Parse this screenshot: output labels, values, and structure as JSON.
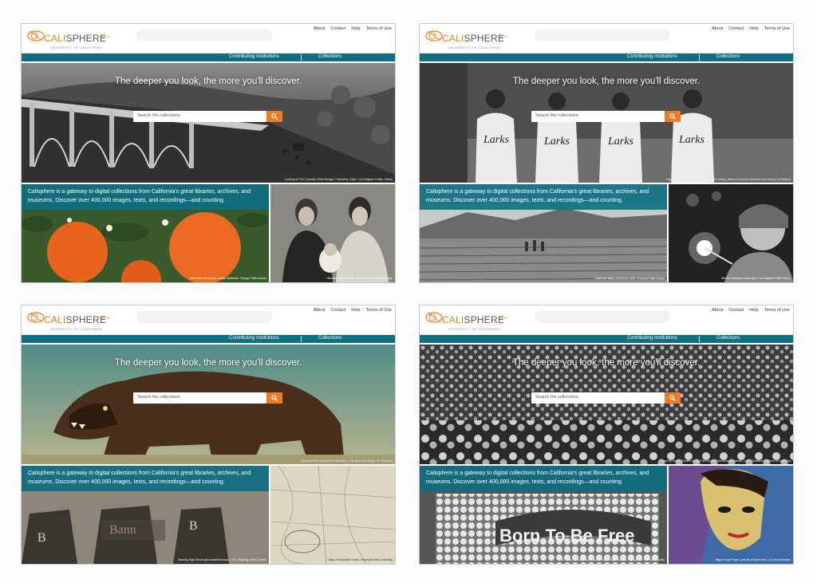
{
  "screens": [
    {
      "logo": {
        "cali": "CALI",
        "sphere": "SPHERE",
        "beta": "BETA",
        "university": "UNIVERSITY OF CALIFORNIA"
      },
      "top_links": [
        "About",
        "Contact",
        "Help",
        "Terms of Use"
      ],
      "nav": {
        "contributing": "Contributing Institutions",
        "collections": "Collections"
      },
      "hero": {
        "tagline": "The deeper you look, the more you'll discover.",
        "search_placeholder": "Search the collections",
        "credit": "Looking at The Colorado Street Bridge, Pasadena, Calif. / Los Angeles Public Library"
      },
      "gateway": "Calisphere is a gateway to digital collections from California's great libraries, archives, and museums. Discover over 400,000 images, texts, and recordings—and counting.",
      "left_caption": "Crate label for Orange County Valencias / Orange Public Library",
      "right_caption": "Hirohata family portrait, 1920s / Anaheim Public Library"
    },
    {
      "logo": {
        "cali": "CALI",
        "sphere": "SPHERE",
        "beta": "BETA",
        "university": "UNIVERSITY OF CALIFORNIA"
      },
      "top_links": [
        "About",
        "Contact",
        "Help",
        "Terms of Use"
      ],
      "nav": {
        "contributing": "Contributing Institutions",
        "collections": "Collections"
      },
      "hero": {
        "tagline": "The deeper you look, the more you'll discover.",
        "search_placeholder": "Search the collections",
        "credit": "Oakland Larks Players / Oakland Public Library, African American Museum and Library at Oakland"
      },
      "gateway": "Calisphere is a gateway to digital collections from California's great libraries, archives, and museums. Discover over 400,000 images, texts, and recordings—and counting.",
      "left_caption": "Coachella Valley onion field, 1920 / Pomona Public Library",
      "right_caption": "Woman holding a metal torch / Los Angeles Public Library"
    },
    {
      "logo": {
        "cali": "CALI",
        "sphere": "SPHERE",
        "beta": "BETA",
        "university": "UNIVERSITY OF CALIFORNIA"
      },
      "top_links": [
        "About",
        "Contact",
        "Help",
        "Terms of Use"
      ],
      "nav": {
        "contributing": "Contributing Institutions",
        "collections": "Collections"
      },
      "hero": {
        "tagline": "The deeper you look, the more you'll discover.",
        "search_placeholder": "Search the collections",
        "credit": "Nucleus Bear Brand fruit crate label / The Bancroft Library, UC Berkeley"
      },
      "gateway": "Calisphere is a gateway to digital collections from California's great libraries, archives, and museums. Discover over 400,000 images, texts, and recordings—and counting.",
      "left_caption": "Banning High School girls basketball team, 1911 / Banning Library District",
      "right_caption": "Atlas of Humboldt County / Humboldt State University"
    },
    {
      "logo": {
        "cali": "CALI",
        "sphere": "SPHERE",
        "beta": "BETA",
        "university": "UNIVERSITY OF CALIFORNIA"
      },
      "top_links": [
        "About",
        "Contact",
        "Help",
        "Terms of Use"
      ],
      "nav": {
        "contributing": "Contributing Institutions",
        "collections": "Collections"
      },
      "hero": {
        "tagline": "The deeper you look, the more you'll discover.",
        "search_placeholder": "Search the collections",
        "credit": "Crowd at Greek Theater during Free Speech Movement protests, 1964 / Oakland Museum of California"
      },
      "gateway": "Calisphere is a gateway to digital collections from California's great libraries, archives, and museums. Discover over 400,000 images, texts, and recordings—and counting.",
      "left_caption": "1977 Gay Freedom Day Parade / Gay Lesbian Bisexual Transgender Historical Society",
      "right_caption": "Miguel Angel Reyes, portrait of Maria Felix / UC Santa Barbara"
    }
  ],
  "theme": {
    "teal": "#0e6e82",
    "orange": "#f07b22"
  },
  "icons": [
    "calisphere-logo-icon",
    "search-icon"
  ]
}
